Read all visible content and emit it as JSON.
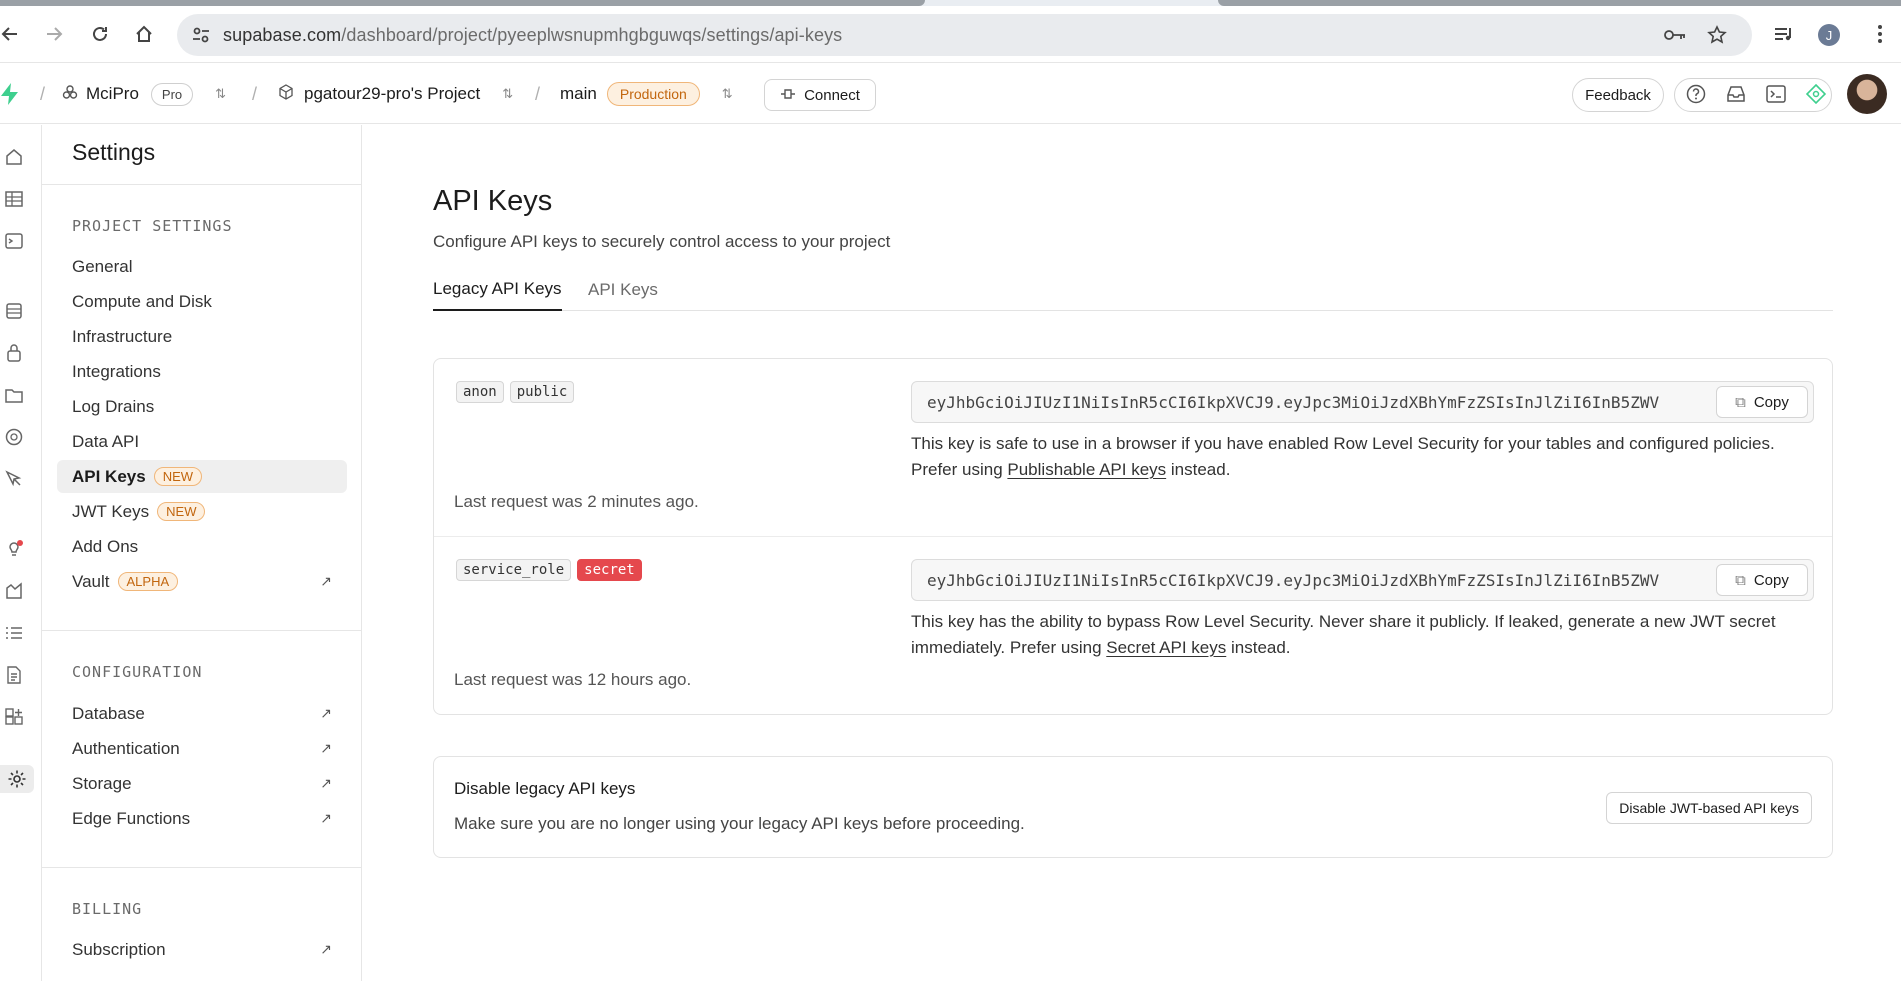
{
  "browser": {
    "url_host": "supabase.com",
    "url_path": "/dashboard/project/pyeeplwsnupmhgbguwqs/settings/api-keys",
    "profile_initial": "J"
  },
  "topbar": {
    "org_name": "MciPro",
    "org_plan": "Pro",
    "project_name": "pgatour29-pro's Project",
    "branch": "main",
    "branch_env": "Production",
    "connect_label": "Connect",
    "feedback_label": "Feedback"
  },
  "sidebar": {
    "title": "Settings",
    "project_heading": "PROJECT SETTINGS",
    "project_items": [
      {
        "label": "General"
      },
      {
        "label": "Compute and Disk"
      },
      {
        "label": "Infrastructure"
      },
      {
        "label": "Integrations"
      },
      {
        "label": "Log Drains"
      },
      {
        "label": "Data API"
      },
      {
        "label": "API Keys",
        "badge": "NEW"
      },
      {
        "label": "JWT Keys",
        "badge": "NEW"
      },
      {
        "label": "Add Ons"
      },
      {
        "label": "Vault",
        "badge": "ALPHA"
      }
    ],
    "config_heading": "CONFIGURATION",
    "config_items": [
      {
        "label": "Database"
      },
      {
        "label": "Authentication"
      },
      {
        "label": "Storage"
      },
      {
        "label": "Edge Functions"
      }
    ],
    "billing_heading": "BILLING",
    "billing_items": [
      {
        "label": "Subscription"
      }
    ]
  },
  "main": {
    "title": "API Keys",
    "subtitle": "Configure API keys to securely control access to your project",
    "tabs": [
      {
        "label": "Legacy API Keys"
      },
      {
        "label": "API Keys"
      }
    ],
    "keys": [
      {
        "tags": [
          "anon",
          "public"
        ],
        "key": "eyJhbGciOiJIUzI1NiIsInR5cCI6IkpXVCJ9.eyJpc3MiOiJzdXBhYmFzZSIsInJlZiI6InB5ZWV",
        "copy_label": "Copy",
        "note_pre": "This key is safe to use in a browser if you have enabled Row Level Security for your tables and configured policies. Prefer using ",
        "note_link": "Publishable API keys",
        "note_post": " instead.",
        "last_request": "Last request was 2 minutes ago."
      },
      {
        "tags": [
          "service_role",
          "secret"
        ],
        "key": "eyJhbGciOiJIUzI1NiIsInR5cCI6IkpXVCJ9.eyJpc3MiOiJzdXBhYmFzZSIsInJlZiI6InB5ZWV",
        "copy_label": "Copy",
        "note_pre": "This key has the ability to bypass Row Level Security. Never share it publicly. If leaked, generate a new JWT secret immediately. Prefer using ",
        "note_link": "Secret API keys",
        "note_post": " instead.",
        "last_request": "Last request was 12 hours ago."
      }
    ],
    "disable": {
      "title": "Disable legacy API keys",
      "subtitle": "Make sure you are no longer using your legacy API keys before proceeding.",
      "button": "Disable JWT-based API keys"
    }
  }
}
